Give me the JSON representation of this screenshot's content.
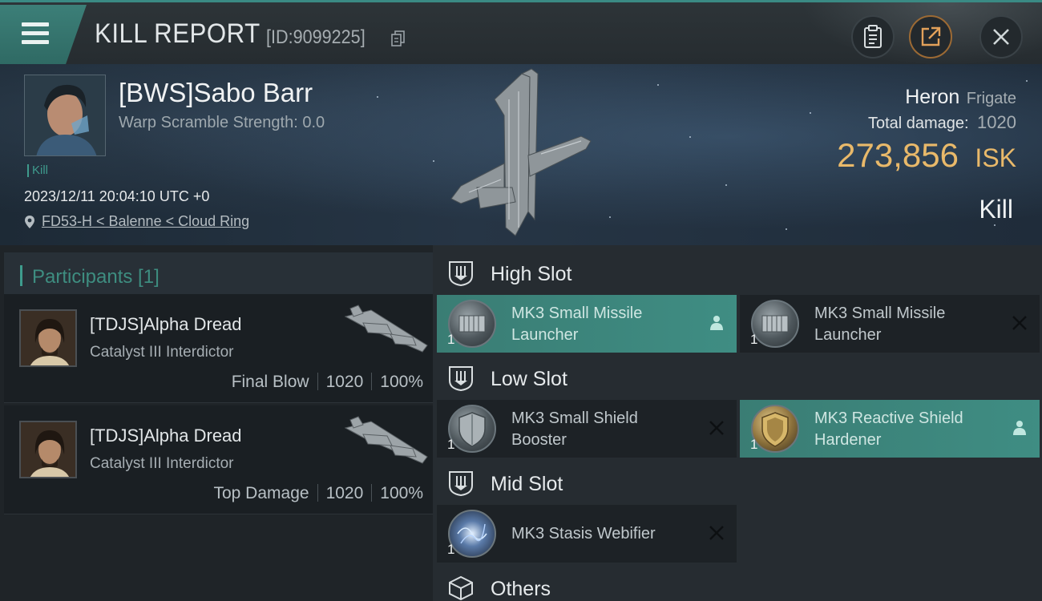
{
  "header": {
    "title": "KILL REPORT",
    "report_id": "[ID:9099225]"
  },
  "victim": {
    "name": "[BWS]Sabo Barr",
    "warp_scramble": "Warp Scramble Strength: 0.0",
    "tag": "Kill",
    "timestamp": "2023/12/11 20:04:10 UTC +0",
    "location": "FD53-H < Balenne < Cloud Ring",
    "ship_name": "Heron",
    "ship_class": "Frigate",
    "total_damage_label": "Total damage:",
    "total_damage_value": "1020",
    "isk_value": "273,856",
    "isk_unit": "ISK",
    "result": "Kill"
  },
  "participants": {
    "title": "Participants [1]",
    "rows": [
      {
        "name": "[TDJS]Alpha Dread",
        "ship": "Catalyst III Interdictor",
        "role": "Final Blow",
        "damage": "1020",
        "percent": "100%"
      },
      {
        "name": "[TDJS]Alpha Dread",
        "ship": "Catalyst III Interdictor",
        "role": "Top Damage",
        "damage": "1020",
        "percent": "100%"
      }
    ]
  },
  "slots": {
    "high": {
      "title": "High Slot",
      "modules": [
        {
          "line1": "MK3 Small Missile",
          "line2": "Launcher",
          "qty": "1",
          "status": "kept"
        },
        {
          "line1": "MK3 Small Missile",
          "line2": "Launcher",
          "qty": "1",
          "status": "destroyed"
        }
      ]
    },
    "low": {
      "title": "Low Slot",
      "modules": [
        {
          "line1": "MK3 Small Shield",
          "line2": "Booster",
          "qty": "1",
          "status": "destroyed"
        },
        {
          "line1": "MK3 Reactive Shield",
          "line2": "Hardener",
          "qty": "1",
          "status": "kept"
        }
      ]
    },
    "mid": {
      "title": "Mid Slot",
      "modules": [
        {
          "line1": "MK3 Stasis Webifier",
          "line2": "",
          "qty": "1",
          "status": "destroyed"
        }
      ]
    },
    "others": {
      "title": "Others"
    }
  },
  "colors": {
    "accent_teal": "#3e9c8d",
    "isk_gold": "#e9b96a",
    "active_module": "#3f8d83"
  }
}
